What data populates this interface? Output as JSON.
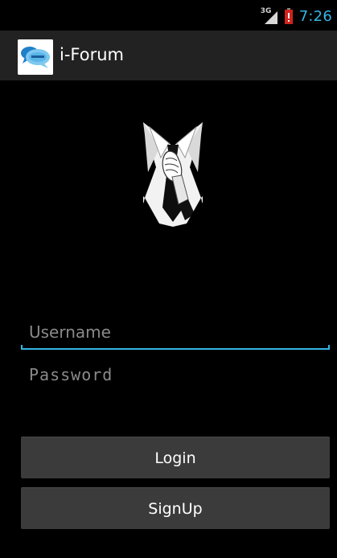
{
  "status_bar": {
    "network_type": "3G",
    "time": "7:26",
    "icons": [
      "signal-icon",
      "battery-low-icon"
    ],
    "clock_color": "#33b5e5"
  },
  "action_bar": {
    "title": "i-Forum",
    "app_icon": "chat-bubbles-logo-icon",
    "background": "#222222"
  },
  "hero": {
    "icon": "suit-and-tie-hand-icon"
  },
  "form": {
    "username": {
      "placeholder": "Username",
      "value": "",
      "focused": true
    },
    "password": {
      "placeholder": "Password",
      "value": ""
    }
  },
  "buttons": {
    "login_label": "Login",
    "signup_label": "SignUp"
  },
  "colors": {
    "accent": "#33b5e5",
    "button_bg": "#3b3b3b",
    "background": "#000000"
  }
}
